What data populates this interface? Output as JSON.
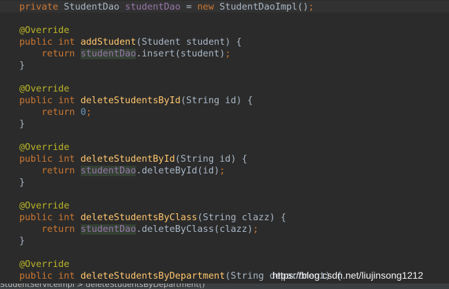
{
  "editor": {
    "lines": [
      [
        {
          "t": "private",
          "c": "kw"
        },
        {
          "t": " StudentDao ",
          "c": ""
        },
        {
          "t": "studentDao",
          "c": "fld"
        },
        {
          "t": " = ",
          "c": ""
        },
        {
          "t": "new",
          "c": "kw"
        },
        {
          "t": " StudentDaoImpl()",
          "c": ""
        },
        {
          "t": ";",
          "c": "kw"
        }
      ],
      [],
      [
        {
          "t": "@Override",
          "c": "ann"
        }
      ],
      [
        {
          "t": "public int",
          "c": "kw"
        },
        {
          "t": " ",
          "c": ""
        },
        {
          "t": "addStudent",
          "c": "fn"
        },
        {
          "t": "(Student student) {",
          "c": ""
        }
      ],
      [
        {
          "t": "    ",
          "c": ""
        },
        {
          "t": "return",
          "c": "kw"
        },
        {
          "t": " ",
          "c": ""
        },
        {
          "t": "studentDao",
          "c": "hl"
        },
        {
          "t": ".insert(student)",
          "c": ""
        },
        {
          "t": ";",
          "c": "kw"
        }
      ],
      [
        {
          "t": "}",
          "c": ""
        }
      ],
      [],
      [
        {
          "t": "@Override",
          "c": "ann"
        }
      ],
      [
        {
          "t": "public int",
          "c": "kw"
        },
        {
          "t": " ",
          "c": ""
        },
        {
          "t": "deleteStudentsById",
          "c": "fn"
        },
        {
          "t": "(String id) {",
          "c": ""
        }
      ],
      [
        {
          "t": "    ",
          "c": ""
        },
        {
          "t": "return",
          "c": "kw"
        },
        {
          "t": " ",
          "c": ""
        },
        {
          "t": "0",
          "c": "num"
        },
        {
          "t": ";",
          "c": "kw"
        }
      ],
      [
        {
          "t": "}",
          "c": ""
        }
      ],
      [],
      [
        {
          "t": "@Override",
          "c": "ann"
        }
      ],
      [
        {
          "t": "public int",
          "c": "kw"
        },
        {
          "t": " ",
          "c": ""
        },
        {
          "t": "deleteStudentById",
          "c": "fn"
        },
        {
          "t": "(String id) {",
          "c": ""
        }
      ],
      [
        {
          "t": "    ",
          "c": ""
        },
        {
          "t": "return",
          "c": "kw"
        },
        {
          "t": " ",
          "c": ""
        },
        {
          "t": "studentDao",
          "c": "hl"
        },
        {
          "t": ".deleteById(id)",
          "c": ""
        },
        {
          "t": ";",
          "c": "kw"
        }
      ],
      [
        {
          "t": "}",
          "c": ""
        }
      ],
      [],
      [
        {
          "t": "@Override",
          "c": "ann"
        }
      ],
      [
        {
          "t": "public int",
          "c": "kw"
        },
        {
          "t": " ",
          "c": ""
        },
        {
          "t": "deleteStudentsByClass",
          "c": "fn"
        },
        {
          "t": "(String clazz) {",
          "c": ""
        }
      ],
      [
        {
          "t": "    ",
          "c": ""
        },
        {
          "t": "return",
          "c": "kw"
        },
        {
          "t": " ",
          "c": ""
        },
        {
          "t": "studentDao",
          "c": "hl"
        },
        {
          "t": ".deleteByClass(clazz)",
          "c": ""
        },
        {
          "t": ";",
          "c": "kw"
        }
      ],
      [
        {
          "t": "}",
          "c": ""
        }
      ],
      [],
      [
        {
          "t": "@Override",
          "c": "ann"
        }
      ],
      [
        {
          "t": "public int",
          "c": "kw"
        },
        {
          "t": " ",
          "c": ""
        },
        {
          "t": "deleteStudentsByDepartment",
          "c": "fn"
        },
        {
          "t": "(String department) {",
          "c": ""
        }
      ]
    ]
  },
  "watermark": "https://blog.csdn.net/liujinsong1212",
  "status_bar": {
    "text": "StudentServiceImpl > deleteStudentsByDepartment()"
  },
  "colors": {
    "background": "#2b2b2b",
    "keyword": "#cc7832",
    "method": "#ffc66d",
    "annotation": "#bbb529",
    "number": "#6897bb",
    "field": "#9876aa",
    "text": "#a9b7c6",
    "usage_highlight": "#344134"
  }
}
